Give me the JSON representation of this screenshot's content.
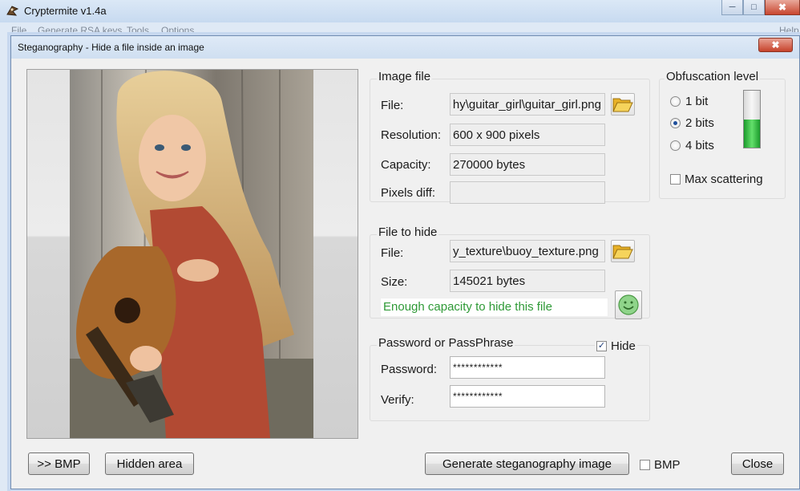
{
  "app": {
    "title": "Cryptermite v1.4a",
    "menu": [
      "File",
      "Generate RSA keys",
      "Tools",
      "Options",
      "Help"
    ],
    "window_buttons": {
      "minimize": "─",
      "maximize": "□",
      "close": "✖"
    }
  },
  "dialog": {
    "title": "Steganography - Hide a file inside an image",
    "close_glyph": "✖"
  },
  "image_file": {
    "group_title": "Image file",
    "file_label": "File:",
    "file_value": "hy\\guitar_girl\\guitar_girl.png",
    "resolution_label": "Resolution:",
    "resolution_value": "600 x 900 pixels",
    "capacity_label": "Capacity:",
    "capacity_value": "270000 bytes",
    "pixels_diff_label": "Pixels diff:",
    "pixels_diff_value": ""
  },
  "obfuscation": {
    "group_title": "Obfuscation level",
    "options": [
      "1 bit",
      "2 bits",
      "4 bits"
    ],
    "selected_index": 1,
    "level_fraction": 0.5,
    "max_scattering_label": "Max scattering",
    "max_scattering_checked": false
  },
  "file_to_hide": {
    "group_title": "File to hide",
    "file_label": "File:",
    "file_value": "y_texture\\buoy_texture.png",
    "size_label": "Size:",
    "size_value": "145021 bytes",
    "status_text": "Enough capacity to hide this file"
  },
  "password": {
    "group_title": "Password or PassPhrase",
    "hide_label": "Hide",
    "hide_checked": true,
    "password_label": "Password:",
    "password_value": "************",
    "verify_label": "Verify:",
    "verify_value": "************"
  },
  "buttons": {
    "to_bmp": ">> BMP",
    "hidden_area": "Hidden area",
    "generate": "Generate steganography image",
    "bmp_checkbox_label": "BMP",
    "close": "Close"
  },
  "colors": {
    "status_green": "#2f9a37",
    "level_green": "#3bc94a",
    "folder_yellow": "#f3c93a"
  },
  "icons": [
    "app-icon",
    "folder-open-icon",
    "smiley-icon",
    "photo-guitar-girl"
  ]
}
